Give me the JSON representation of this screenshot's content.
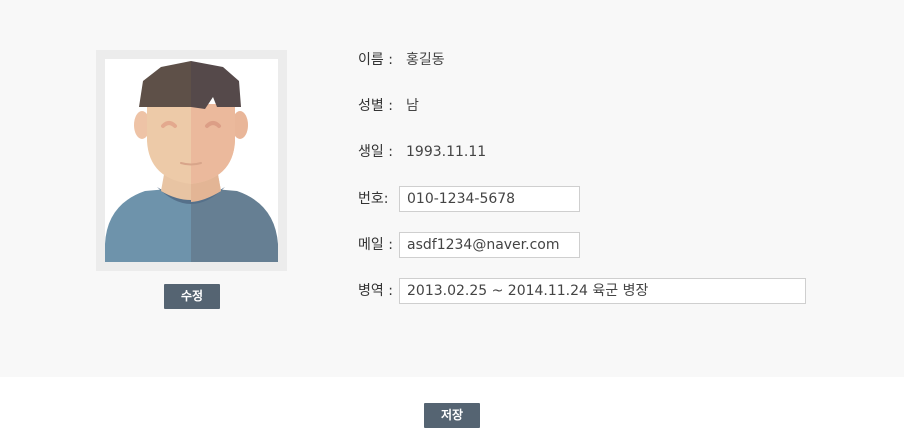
{
  "profile": {
    "photo_icon": "person-avatar-illustration",
    "edit_button": "수정"
  },
  "fields": {
    "name": {
      "label": "이름 :",
      "value": "홍길동"
    },
    "gender": {
      "label": "성별 :",
      "value": "남"
    },
    "birth": {
      "label": "생일 :",
      "value": "1993.11.11"
    },
    "phone": {
      "label": "번호:",
      "value": "010-1234-5678"
    },
    "email": {
      "label": "메일 :",
      "value": "asdf1234@naver.com"
    },
    "military": {
      "label": "병역 :",
      "value": "2013.02.25 ~ 2014.11.24 육군 병장"
    }
  },
  "footer": {
    "save_button": "저장"
  },
  "colors": {
    "panel_bg": "#f8f8f8",
    "button_bg": "#556472",
    "frame_bg": "#ececec"
  }
}
